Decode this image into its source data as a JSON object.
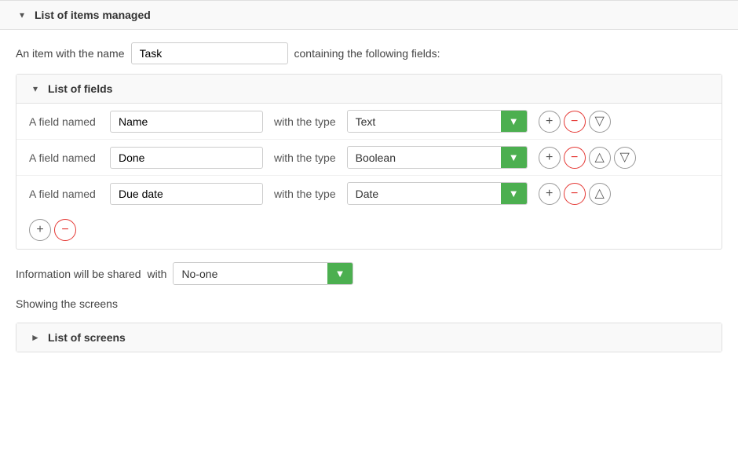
{
  "sections": {
    "items_managed": {
      "title": "List of items managed",
      "expanded": true
    },
    "fields": {
      "title": "List of fields",
      "expanded": true
    },
    "screens": {
      "title": "List of screens",
      "expanded": false
    }
  },
  "item_name_prefix": "An item with the name",
  "item_name_value": "Task",
  "item_name_suffix": "containing the following fields:",
  "fields": [
    {
      "name": "Name",
      "type": "Text"
    },
    {
      "name": "Done",
      "type": "Boolean"
    },
    {
      "name": "Due date",
      "type": "Date"
    }
  ],
  "field_label": "A field named",
  "type_label": "with the type",
  "type_label_cursor": "with the type",
  "sharing_prefix": "Information will be shared",
  "sharing_connector": "with",
  "sharing_value": "No-one",
  "showing_label": "Showing the screens",
  "buttons": {
    "dropdown_arrow": "▾",
    "add": "+",
    "remove": "−",
    "move_up": "△",
    "move_down": "▽"
  }
}
